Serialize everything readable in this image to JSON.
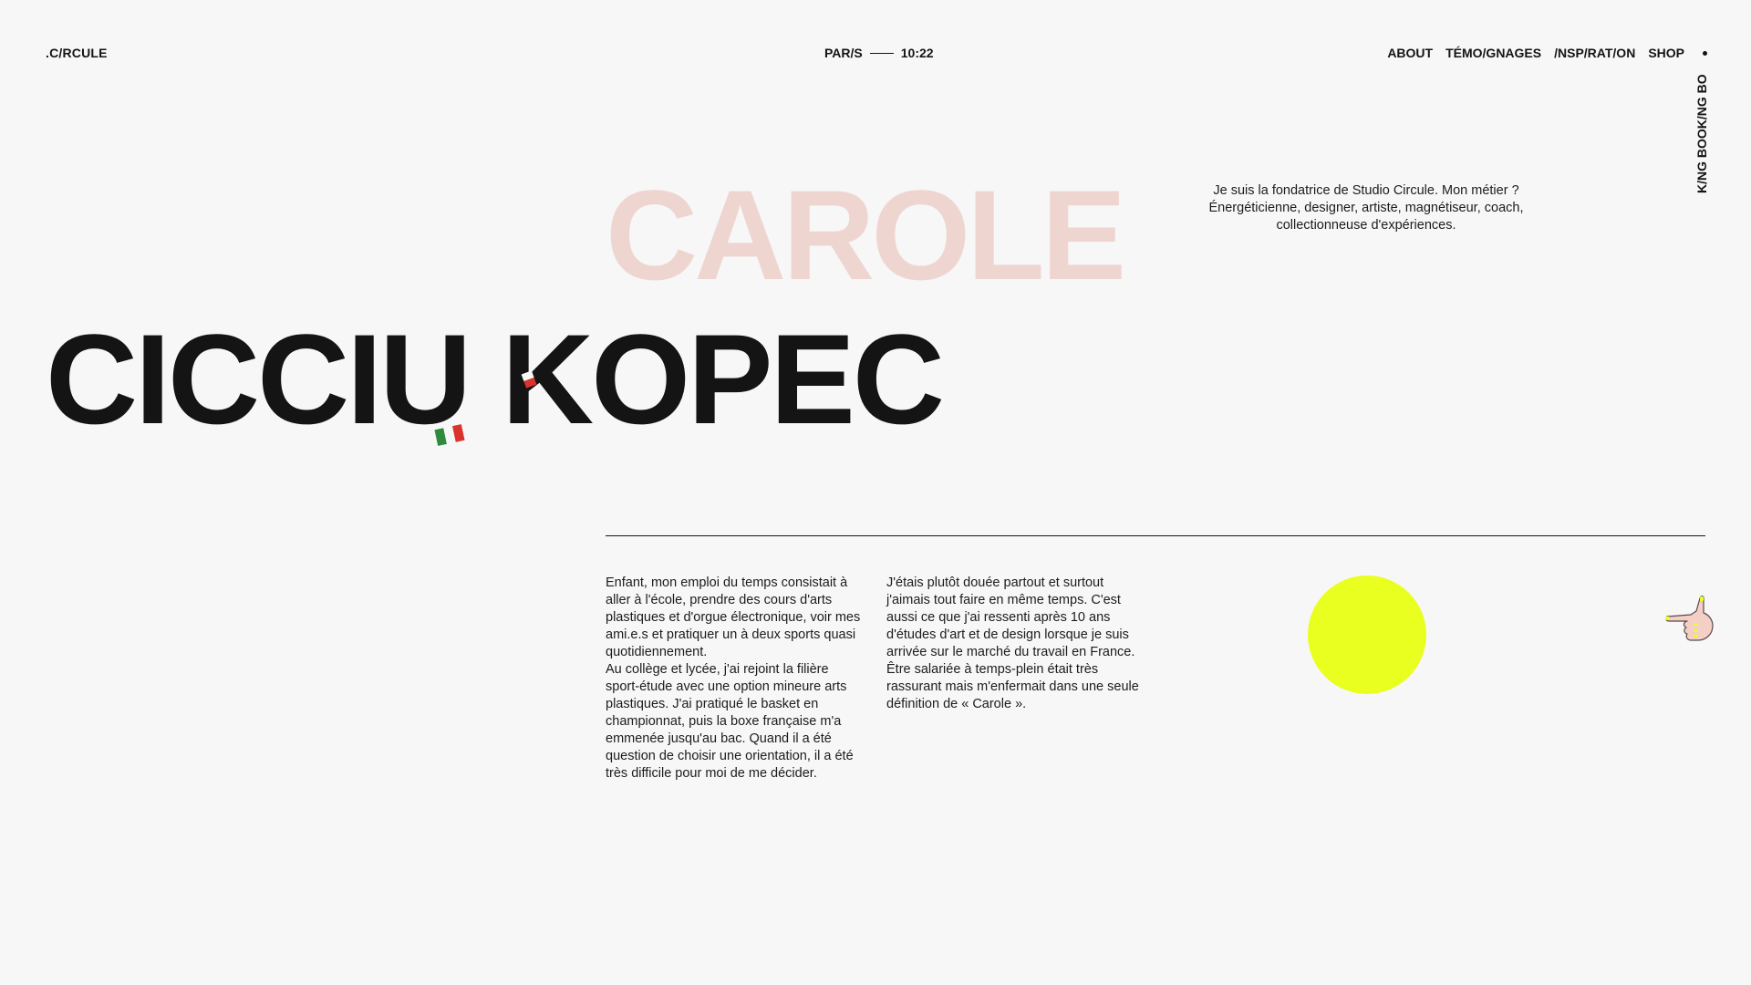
{
  "header": {
    "logo": ".C/RCULE",
    "city": "PAR/S",
    "time": "10:22",
    "nav": [
      "ABOUT",
      "TÉMO/GNAGES",
      "/NSP/RAT/ON",
      "SHOP"
    ]
  },
  "side_link": "K/NG BOOK/NG BO",
  "hero": {
    "first_name": "CAROLE",
    "last_name": "CICCIU KOPEC"
  },
  "intro": {
    "text": "Je suis la fondatrice de Studio Circule. Mon métier ? Énergéticienne, designer, artiste, magnétiseur, coach, collectionneuse d'expériences."
  },
  "story": {
    "col1_p1": "Enfant, mon emploi du temps consistait à aller à l'école, prendre des cours d'arts plastiques et d'orgue électronique, voir mes ami.e.s et pratiquer un à deux sports quasi quotidiennement.",
    "col1_p2": "Au collège et lycée, j'ai rejoint la filière sport-étude avec une option mineure arts plastiques. J'ai pratiqué le basket en championnat, puis la boxe française m'a emmenée jusqu'au bac. Quand il a été question de choisir une orientation, il a été très difficile pour moi de me décider.",
    "col2_p1": "J'étais plutôt douée partout et surtout j'aimais tout faire en même temps. C'est aussi ce que j'ai ressenti après 10 ans d'études d'art et de design lorsque je suis arrivée sur le marché du travail en France. Être salariée à temps-plein était très rassurant mais m'enfermait dans une seule définition de « Carole »."
  },
  "colors": {
    "background": "#f7f7f7",
    "text": "#141414",
    "first_name": "#efd5cf",
    "accent_circle": "#e9ff1f",
    "flag_green": "#2e8b3e",
    "flag_red": "#d9332b"
  },
  "icons": {
    "flag": "italian-flag-icon",
    "hand": "pointing-hand-icon",
    "nav_dot": "dot-icon"
  }
}
